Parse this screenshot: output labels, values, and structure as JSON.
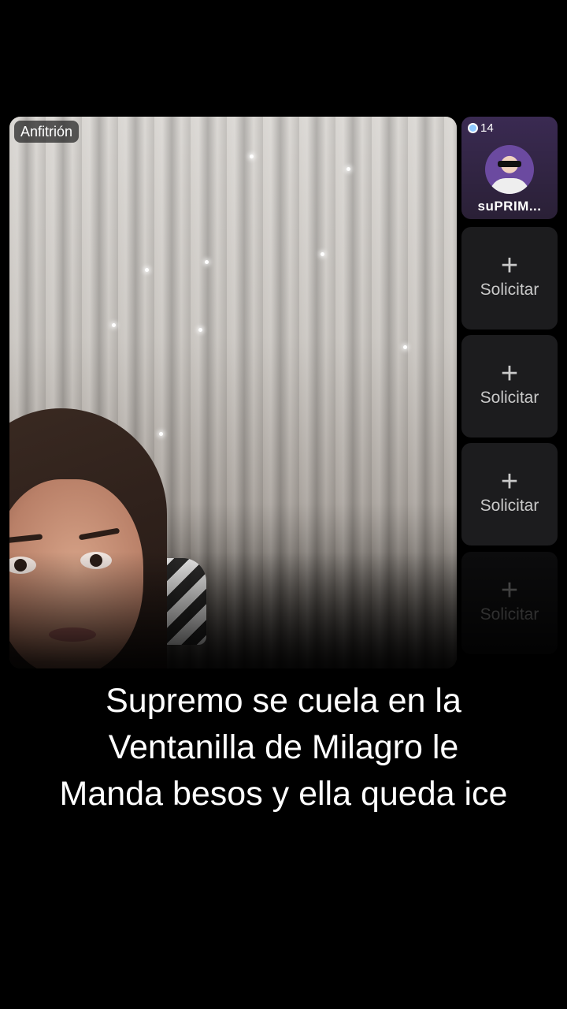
{
  "host": {
    "badge": "Anfitrión"
  },
  "guests": {
    "viewer_count": "14",
    "user_name": "suPRIM...",
    "empty_seat_label": "Solicitar",
    "plus_symbol": "+"
  },
  "caption": {
    "line1": "Supremo se cuela en la",
    "line2": "Ventanilla de Milagro le",
    "line3": "Manda besos y ella queda ice"
  },
  "icons": {
    "viewer": "eye-icon",
    "add": "plus-icon"
  }
}
